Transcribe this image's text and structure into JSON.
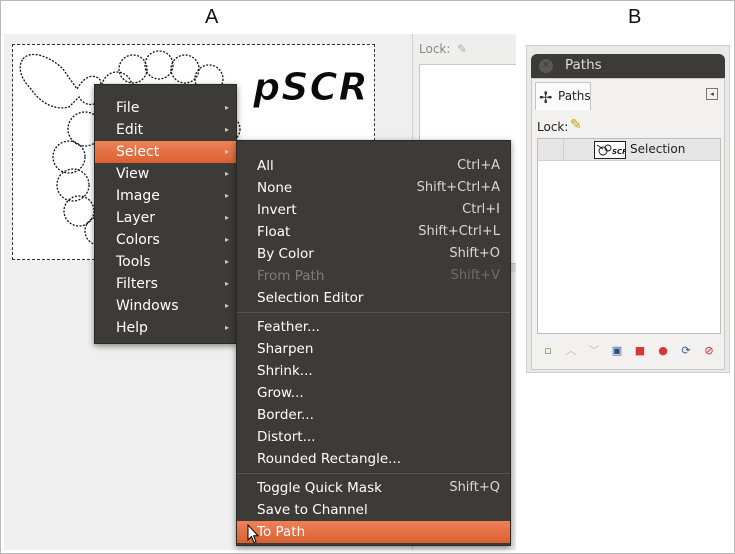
{
  "labels": {
    "panel_a": "A",
    "panel_b": "B"
  },
  "canvas": {
    "lock_label": "Lock:",
    "image_text": "pSCR"
  },
  "main_menu": {
    "items": [
      {
        "label": "File",
        "arrow": "▸"
      },
      {
        "label": "Edit",
        "arrow": "▸"
      },
      {
        "label": "Select",
        "arrow": "▸",
        "active": true
      },
      {
        "label": "View",
        "arrow": "▸"
      },
      {
        "label": "Image",
        "arrow": "▸"
      },
      {
        "label": "Layer",
        "arrow": "▸"
      },
      {
        "label": "Colors",
        "arrow": "▸"
      },
      {
        "label": "Tools",
        "arrow": "▸"
      },
      {
        "label": "Filters",
        "arrow": "▸"
      },
      {
        "label": "Windows",
        "arrow": "▸"
      },
      {
        "label": "Help",
        "arrow": "▸"
      }
    ]
  },
  "select_menu": {
    "group1": [
      {
        "label": "All",
        "shortcut": "Ctrl+A"
      },
      {
        "label": "None",
        "shortcut": "Shift+Ctrl+A"
      },
      {
        "label": "Invert",
        "shortcut": "Ctrl+I"
      },
      {
        "label": "Float",
        "shortcut": "Shift+Ctrl+L"
      },
      {
        "label": "By Color",
        "shortcut": "Shift+O"
      },
      {
        "label": "From Path",
        "shortcut": "Shift+V",
        "disabled": true
      },
      {
        "label": "Selection Editor",
        "shortcut": ""
      }
    ],
    "group2": [
      {
        "label": "Feather..."
      },
      {
        "label": "Sharpen"
      },
      {
        "label": "Shrink..."
      },
      {
        "label": "Grow..."
      },
      {
        "label": "Border..."
      },
      {
        "label": "Distort..."
      },
      {
        "label": "Rounded Rectangle..."
      }
    ],
    "group3": [
      {
        "label": "Toggle Quick Mask",
        "shortcut": "Shift+Q"
      },
      {
        "label": "Save to Channel",
        "shortcut": ""
      },
      {
        "label": "To Path",
        "shortcut": "",
        "active": true
      }
    ]
  },
  "paths_dock": {
    "title": "Paths",
    "close_glyph": "✕",
    "tab_label": "Paths",
    "menu_glyph": "◂",
    "lock_label": "Lock:",
    "path_row": {
      "label": "Selection"
    },
    "tools": [
      {
        "name": "new-path-icon",
        "glyph": "▫",
        "color": "#6a8a2a"
      },
      {
        "name": "raise-path-icon",
        "glyph": "︿",
        "color": "#b9b9b9"
      },
      {
        "name": "lower-path-icon",
        "glyph": "﹀",
        "color": "#b9b9b9"
      },
      {
        "name": "duplicate-path-icon",
        "glyph": "▣",
        "color": "#2c4a8a"
      },
      {
        "name": "path-to-selection-icon",
        "glyph": "■",
        "color": "#d23a3a"
      },
      {
        "name": "selection-to-path-icon",
        "glyph": "●",
        "color": "#d23a3a"
      },
      {
        "name": "paint-along-path-icon",
        "glyph": "⟳",
        "color": "#3a5a9a"
      },
      {
        "name": "delete-path-icon",
        "glyph": "⊘",
        "color": "#cc1f1f"
      }
    ]
  }
}
